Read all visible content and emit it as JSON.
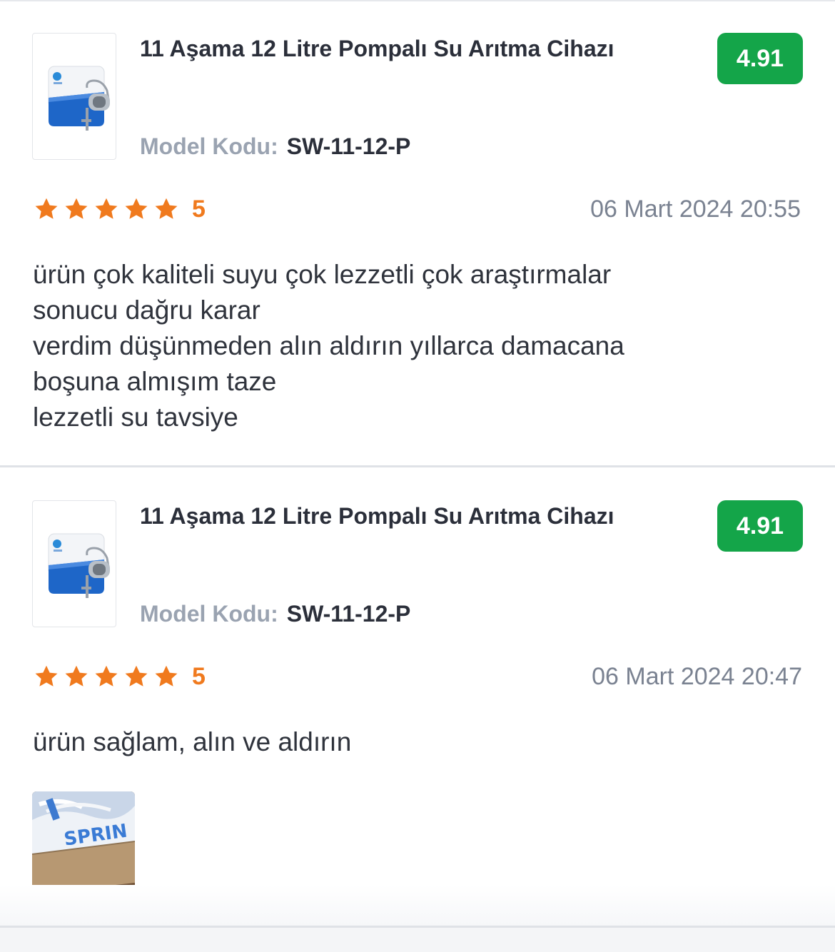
{
  "reviews": [
    {
      "product_title": "11 Aşama 12 Litre Pompalı Su Arıtma Cihazı",
      "score": "4.91",
      "model_label": "Model Kodu:",
      "model_code": "SW-11-12-P",
      "rating": 5,
      "rating_text": "5",
      "date": "06 Mart 2024 20:55",
      "comment_lines": [
        "ürün çok kaliteli suyu çok lezzetli çok araştırmalar",
        "sonucu dağru karar",
        "verdim düşünmeden alın aldırın yıllarca damacana",
        "boşuna almışım taze",
        "lezzetli su tavsiye"
      ]
    },
    {
      "product_title": "11 Aşama 12 Litre Pompalı Su Arıtma Cihazı",
      "score": "4.91",
      "model_label": "Model Kodu:",
      "model_code": "SW-11-12-P",
      "rating": 5,
      "rating_text": "5",
      "date": "06 Mart 2024 20:47",
      "comment_lines": [
        "ürün sağlam, alın ve aldırın"
      ],
      "photo_text": "SPRIN"
    }
  ],
  "colors": {
    "score_badge": "#14a549",
    "star": "#f07a1e",
    "model_label": "#9aa3b1",
    "date": "#7a8291"
  },
  "icons": {
    "star": "star-icon",
    "product": "water-purifier-image"
  }
}
